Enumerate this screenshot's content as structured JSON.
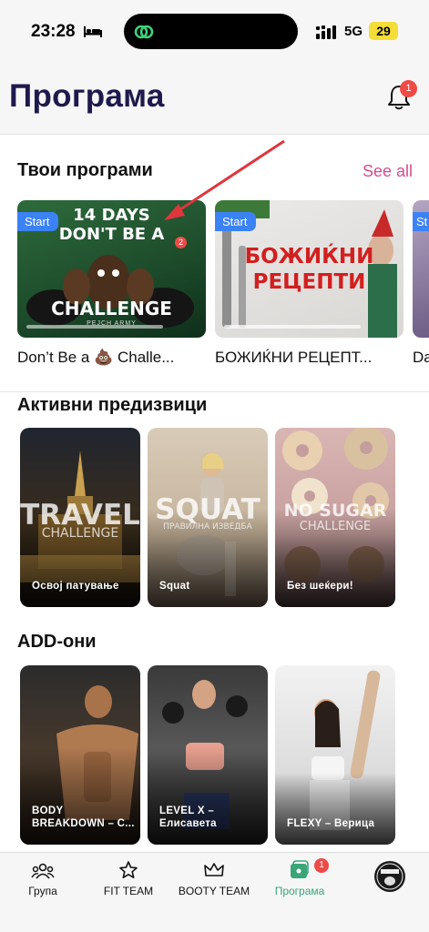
{
  "status_bar": {
    "time": "23:28",
    "network": "5G",
    "battery": "29"
  },
  "header": {
    "title": "Програма",
    "notification_count": "1"
  },
  "your_programs": {
    "title": "Твои програми",
    "see_all": "See all",
    "cards": [
      {
        "start_label": "Start",
        "title": "Don’t Be a 💩 Challe...",
        "art_line1": "14 DAYS",
        "art_line2": "DON'T BE A",
        "art_line3": "CHALLENGE",
        "art_badge": "2",
        "art_brand": "PEJCH ARMY"
      },
      {
        "start_label": "Start",
        "title": "БОЖИЌНИ РЕЦЕПТ...",
        "art_line1": "БОЖИЌНИ",
        "art_line2": "РЕЦЕПТИ"
      },
      {
        "start_label": "St",
        "title": "Da"
      }
    ]
  },
  "challenges": {
    "title": "Активни предизвици",
    "cards": [
      {
        "label": "Освој патување",
        "big": "TRAVEL",
        "small": "CHALLENGE"
      },
      {
        "label": "Squat",
        "big": "SQUAT",
        "small": "ПРАВИЛНА ИЗВЕДБА"
      },
      {
        "label": "Без шеќери!",
        "big": "NO SUGAR",
        "small": "CHALLENGE"
      }
    ]
  },
  "addons": {
    "title": "ADD-они",
    "cards": [
      {
        "label_line1": "BODY",
        "label_line2": "BREAKDOWN – C..."
      },
      {
        "label_line1": "LEVEL X –",
        "label_line2": "Елисавета"
      },
      {
        "label_line1": "FLEXY – Верица",
        "label_line2": ""
      }
    ]
  },
  "tabbar": {
    "tabs": [
      {
        "label": "Група",
        "icon": "group-icon"
      },
      {
        "label": "FIT TEAM",
        "icon": "star-icon"
      },
      {
        "label": "BOOTY TEAM",
        "icon": "crown-icon"
      },
      {
        "label": "Програма",
        "icon": "program-icon",
        "badge": "1",
        "active": true
      },
      {
        "label": "",
        "icon": "profile-avatar"
      }
    ]
  },
  "colors": {
    "accent_pink": "#d64d8a",
    "active_green": "#3aa577",
    "badge_red": "#ef4a46",
    "start_blue": "#3b82f6",
    "title_navy": "#1e1a4d"
  }
}
